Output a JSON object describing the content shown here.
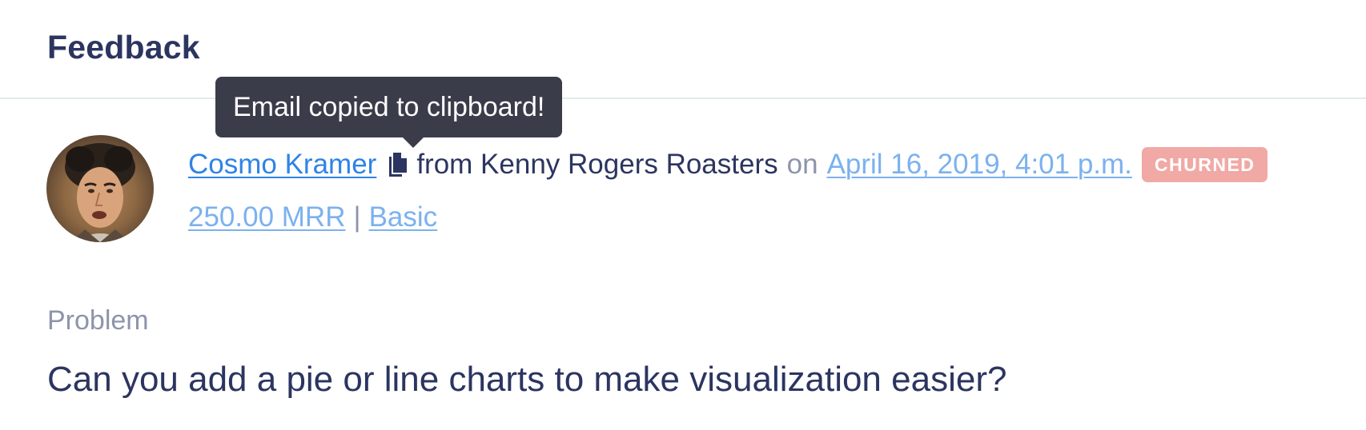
{
  "header": {
    "title": "Feedback"
  },
  "tooltip": {
    "text": "Email copied to clipboard!"
  },
  "feedback": {
    "customer_name": "Cosmo Kramer",
    "copy_icon": "copy-icon",
    "from_text": "from Kenny Rogers Roasters",
    "on_text": "on",
    "date": "April 16, 2019, 4:01 p.m.",
    "status_badge": "CHURNED",
    "mrr": "250.00 MRR",
    "separator": "|",
    "plan": "Basic"
  },
  "problem": {
    "label": "Problem",
    "text": "Can you add a pie or line charts to make visualization easier?"
  },
  "colors": {
    "primary_text": "#2c3560",
    "link_blue": "#2f83e6",
    "link_light": "#7bb1ef",
    "muted": "#8d94ab",
    "badge_bg": "#f1a9a5",
    "tooltip_bg": "#3a3c4a"
  }
}
